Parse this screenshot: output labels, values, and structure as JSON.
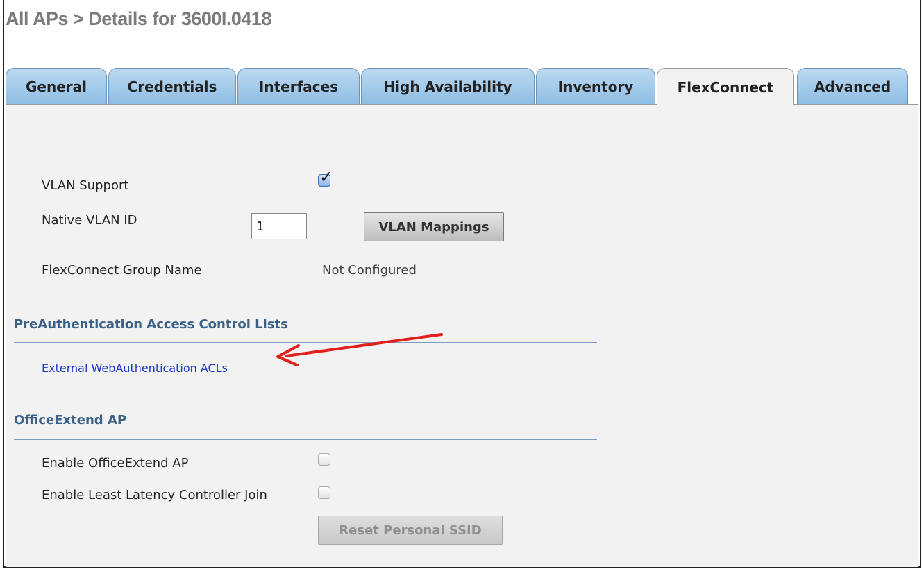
{
  "page_title": "All APs > Details for 3600I.0418",
  "tabs": [
    {
      "label": "General"
    },
    {
      "label": "Credentials"
    },
    {
      "label": "Interfaces"
    },
    {
      "label": "High Availability"
    },
    {
      "label": "Inventory"
    },
    {
      "label": "FlexConnect",
      "active": true
    },
    {
      "label": "Advanced"
    }
  ],
  "flexconnect": {
    "vlan_support_label": "VLAN Support",
    "vlan_support_checked": true,
    "native_vlan_label": "Native VLAN ID",
    "native_vlan_value": "1",
    "vlan_mappings_button": "VLAN Mappings",
    "group_name_label": "FlexConnect Group Name",
    "group_name_value": "Not Configured"
  },
  "preauth": {
    "heading": "PreAuthentication Access Control Lists",
    "link": "External WebAuthentication ACLs"
  },
  "office_extend": {
    "heading": "OfficeExtend AP",
    "enable_label": "Enable OfficeExtend AP",
    "enable_checked": false,
    "least_latency_label": "Enable Least Latency Controller Join",
    "least_latency_checked": false,
    "reset_button": "Reset Personal SSID"
  },
  "colors": {
    "tab_blue": "#8ebde4",
    "section_heading": "#3c6186",
    "link": "#1a37c7",
    "annotation_arrow": "#e0201c"
  }
}
